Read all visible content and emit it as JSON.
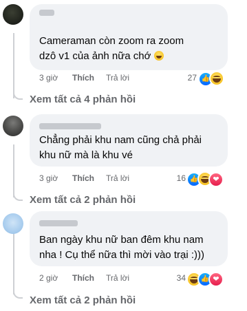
{
  "comments": [
    {
      "text": "Cameraman còn zoom ra zoom\ndzô v1 của ảnh nữa chớ",
      "time": "3 giờ",
      "like_label": "Thích",
      "reply_label": "Trả lời",
      "reaction_count": "27",
      "reactions": [
        "like",
        "haha"
      ],
      "view_replies": "Xem tất cả 4 phản hồi"
    },
    {
      "text": "Chẳng phải khu nam cũng chả phải\nkhu nữ mà là khu vé",
      "time": "3 giờ",
      "like_label": "Thích",
      "reply_label": "Trả lời",
      "reaction_count": "16",
      "reactions": [
        "like",
        "haha",
        "love"
      ],
      "view_replies": "Xem tất cả 2 phản hồi"
    },
    {
      "text": "Ban ngày khu nữ ban đêm khu nam\nnha ! Cụ thể nữa thì mời vào trại :)))",
      "time": "2 giờ",
      "like_label": "Thích",
      "reply_label": "Trả lời",
      "reaction_count": "34",
      "reactions": [
        "haha",
        "like",
        "love"
      ],
      "view_replies": "Xem tất cả 2 phản hồi"
    }
  ],
  "colors": {
    "bubble": "#f0f2f5",
    "meta_text": "#65676b",
    "like_blue": "#0866ff",
    "love_red": "#e61e4d",
    "haha_yellow": "#f7c325"
  },
  "icons": [
    "like-reaction-icon",
    "haha-reaction-icon",
    "love-reaction-icon",
    "grinning-emoji-icon"
  ]
}
